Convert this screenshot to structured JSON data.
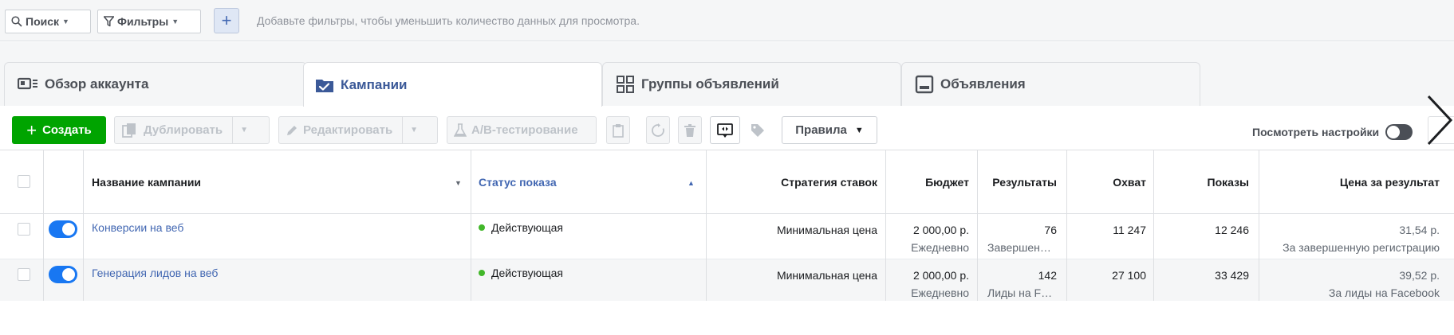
{
  "filter_bar": {
    "search_label": "Поиск",
    "filters_label": "Фильтры",
    "add_button_label": "+",
    "hint": "Добавьте фильтры, чтобы уменьшить количество данных для просмотра."
  },
  "tabs": [
    {
      "label": "Обзор аккаунта",
      "icon": "account-overview-icon",
      "active": false
    },
    {
      "label": "Кампании",
      "icon": "folder-icon",
      "active": true
    },
    {
      "label": "Группы объявлений",
      "icon": "grid-icon",
      "active": false
    },
    {
      "label": "Объявления",
      "icon": "ad-icon",
      "active": false
    }
  ],
  "toolbar": {
    "create_label": "Создать",
    "duplicate_label": "Дублировать",
    "edit_label": "Редактировать",
    "ab_test_label": "A/B-тестирование",
    "rules_label": "Правила",
    "view_settings_label": "Посмотреть настройки",
    "view_settings_enabled": false
  },
  "table": {
    "columns": {
      "name": "Название кампании",
      "status": "Статус показа",
      "bid_strategy": "Стратегия ставок",
      "budget": "Бюджет",
      "results": "Результаты",
      "reach": "Охват",
      "impressions": "Показы",
      "cost_per_result": "Цена за результат"
    },
    "rows": [
      {
        "enabled": true,
        "name": "Конверсии на веб",
        "status": "Действующая",
        "bid_strategy": "Минимальная цена",
        "budget": "2 000,00 р.",
        "budget_type": "Ежедневно",
        "results": "76",
        "results_type": "Завершен…",
        "reach": "11 247",
        "impressions": "12 246",
        "cost_per_result": "31,54 р.",
        "cost_per_result_type": "За завершенную регистрацию"
      },
      {
        "enabled": true,
        "name": "Генерация лидов на веб",
        "status": "Действующая",
        "bid_strategy": "Минимальная цена",
        "budget": "2 000,00 р.",
        "budget_type": "Ежедневно",
        "results": "142",
        "results_type": "Лиды на F…",
        "reach": "27 100",
        "impressions": "33 429",
        "cost_per_result": "39,52 р.",
        "cost_per_result_type": "За лиды на Facebook"
      }
    ]
  },
  "colors": {
    "accent": "#4267b2",
    "create_button": "#00a400",
    "toggle_on": "#1877f2",
    "status_active": "#42b72a"
  }
}
